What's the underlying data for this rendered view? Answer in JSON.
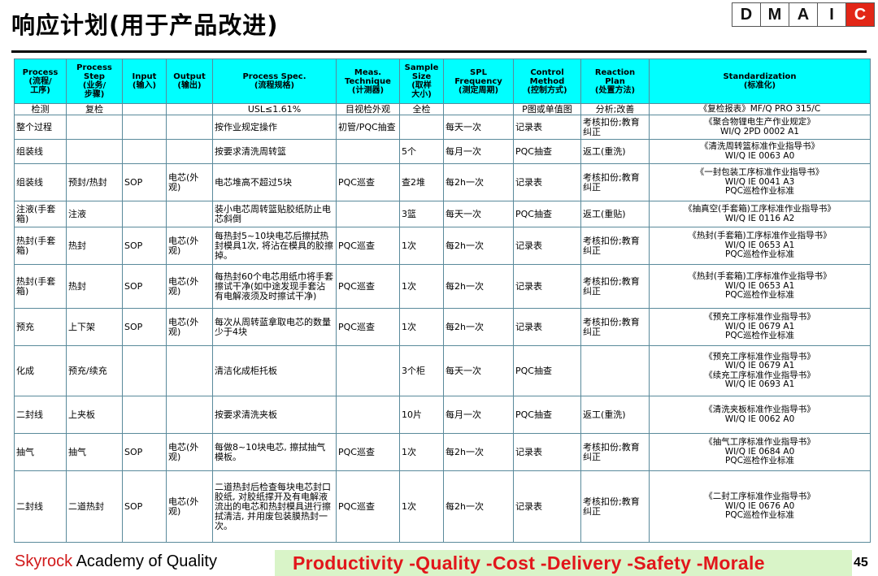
{
  "title": "响应计划(用于产品改进)",
  "dmaic": [
    "D",
    "M",
    "A",
    "I",
    "C"
  ],
  "colors": {
    "header_bg": "#00ffff",
    "active_phase": "#e22617",
    "banner_bg": "#d9f4c8",
    "banner_text": "#e2161b"
  },
  "headers": [
    [
      "Process",
      "(流程/",
      "工序)"
    ],
    [
      "Process",
      "Step",
      "(业务/",
      "步骤)"
    ],
    [
      "Input",
      "(输入)"
    ],
    [
      "Output",
      "(输出)"
    ],
    [
      "Process Spec.",
      "(流程规格)"
    ],
    [
      "Meas.",
      "Technique",
      "(计测器)"
    ],
    [
      "Sample",
      "Size",
      "(取样",
      "大小)"
    ],
    [
      "SPL",
      "Frequency",
      "(测定周期)"
    ],
    [
      "Control",
      "Method",
      "(控制方式)"
    ],
    [
      "Reaction",
      "Plan",
      "(处置方法)"
    ],
    [
      "Standardization",
      "(标准化)"
    ]
  ],
  "first_row": {
    "process": "检测",
    "step": "复检",
    "input": "",
    "output": "",
    "spec": "USL≤1.61%",
    "meas": "目视检外观",
    "sample": "全检",
    "freq": "",
    "control": "P图或单值图",
    "reaction": "分析;改善",
    "std": [
      "《复检报表》MF/Q PRO 315/C"
    ]
  },
  "rows": [
    {
      "process": "整个过程",
      "step": "",
      "input": "",
      "output": "",
      "spec": "按作业规定操作",
      "meas": "初管/PQC抽查",
      "sample": "",
      "freq": "每天一次",
      "control": "记录表",
      "reaction": "考核扣份;教育纠正",
      "std": [
        "《聚合物锂电生产作业规定》",
        "WI/Q 2PD 0002 A1"
      ]
    },
    {
      "process": "组装线",
      "step": "",
      "input": "",
      "output": "",
      "spec": "按要求清洗周转篮",
      "meas": "",
      "sample": "5个",
      "freq": "每月一次",
      "control": "PQC抽查",
      "reaction": "返工(重洗)",
      "std": [
        "《清洗周转篮标准作业指导书》",
        "WI/Q IE 0063 A0"
      ]
    },
    {
      "process": "组装线",
      "step": "预封/热封",
      "input": "SOP",
      "output": "电芯(外观)",
      "spec": "电芯堆高不超过5块",
      "meas": "PQC巡查",
      "sample": "查2堆",
      "freq": "每2h一次",
      "control": "记录表",
      "reaction": "考核扣份;教育纠正",
      "std": [
        "《一封包装工序标准作业指导书》",
        "WI/Q IE 0041 A3",
        "PQC巡检作业标准"
      ]
    },
    {
      "process": "注液(手套箱)",
      "step": "注液",
      "input": "",
      "output": "",
      "spec": "装小电芯周转篮贴胶纸防止电芯斜倒",
      "meas": "",
      "sample": "3篮",
      "freq": "每天一次",
      "control": "PQC抽查",
      "reaction": "返工(重贴)",
      "std": [
        "《抽真空(手套箱)工序标准作业指导书》",
        "WI/Q IE 0116 A2"
      ]
    },
    {
      "process": "热封(手套箱)",
      "step": "热封",
      "input": "SOP",
      "output": "电芯(外观)",
      "spec": "每热封5~10块电芯后擦拭热封模具1次, 将沾在模具的胶擦掉。",
      "meas": "PQC巡查",
      "sample": "1次",
      "freq": "每2h一次",
      "control": "记录表",
      "reaction": "考核扣份;教育纠正",
      "std": [
        "《热封(手套箱)工序标准作业指导书》",
        "WI/Q IE 0653 A1",
        "PQC巡检作业标准"
      ]
    },
    {
      "process": "热封(手套箱)",
      "step": "热封",
      "input": "SOP",
      "output": "电芯(外观)",
      "spec": "每热封60个电芯用纸巾将手套擦试干净(如中途发现手套沾有电解液须及时擦试干净)",
      "meas": "PQC巡查",
      "sample": "1次",
      "freq": "每2h一次",
      "control": "记录表",
      "reaction": "考核扣份;教育纠正",
      "std": [
        "《热封(手套箱)工序标准作业指导书》",
        "WI/Q IE 0653 A1",
        "PQC巡检作业标准"
      ]
    },
    {
      "process": "预充",
      "step": "上下架",
      "input": "SOP",
      "output": "电芯(外观)",
      "spec": "每次从周转蓝拿取电芯的数量少于4块",
      "meas": "PQC巡查",
      "sample": "1次",
      "freq": "每2h一次",
      "control": "记录表",
      "reaction": "考核扣份;教育纠正",
      "std": [
        "《预充工序标准作业指导书》",
        "WI/Q IE 0679 A1",
        "PQC巡检作业标准"
      ]
    },
    {
      "process": "化成",
      "step": "预充/续充",
      "input": "",
      "output": "",
      "spec": "清洁化成柜托板",
      "meas": "",
      "sample": "3个柜",
      "freq": "每天一次",
      "control": "PQC抽查",
      "reaction": "",
      "std": [
        "《预充工序标准作业指导书》",
        "WI/Q IE 0679 A1",
        "《续充工序标准作业指导书》",
        "WI/Q IE 0693 A1"
      ]
    },
    {
      "process": "二封线",
      "step": "上夹板",
      "input": "",
      "output": "",
      "spec": "按要求清洗夹板",
      "meas": "",
      "sample": "10片",
      "freq": "每月一次",
      "control": "PQC抽查",
      "reaction": "返工(重洗)",
      "std": [
        "《清洗夹板标准作业指导书》",
        "WI/Q IE 0062 A0"
      ]
    },
    {
      "process": "抽气",
      "step": "抽气",
      "input": "SOP",
      "output": "电芯(外观)",
      "spec": "每做8~10块电芯, 擦拭抽气模板。",
      "meas": "PQC巡查",
      "sample": "1次",
      "freq": "每2h一次",
      "control": "记录表",
      "reaction": "考核扣份;教育纠正",
      "std": [
        "《抽气工序标准作业指导书》",
        "WI/Q IE 0684 A0",
        "PQC巡检作业标准"
      ]
    },
    {
      "process": "二封线",
      "step": "二道热封",
      "input": "SOP",
      "output": "电芯(外观)",
      "spec": "二道热封后检查每块电芯封口胶纸, 对胶纸撑开及有电解液流出的电芯和热封模具进行擦拭清洁, 并用废包装膜热封一次。",
      "meas": "PQC巡查",
      "sample": "1次",
      "freq": "每2h一次",
      "control": "记录表",
      "reaction": "考核扣份;教育纠正",
      "std": [
        "《二封工序标准作业指导书》",
        "WI/Q IE 0676 A0",
        "PQC巡检作业标准"
      ]
    }
  ],
  "footer": {
    "brand": "Skyrock",
    "academy": "Academy of Quality",
    "banner": "Productivity  -Quality  -Cost   -Delivery  -Safety  -Morale",
    "page": "45"
  }
}
